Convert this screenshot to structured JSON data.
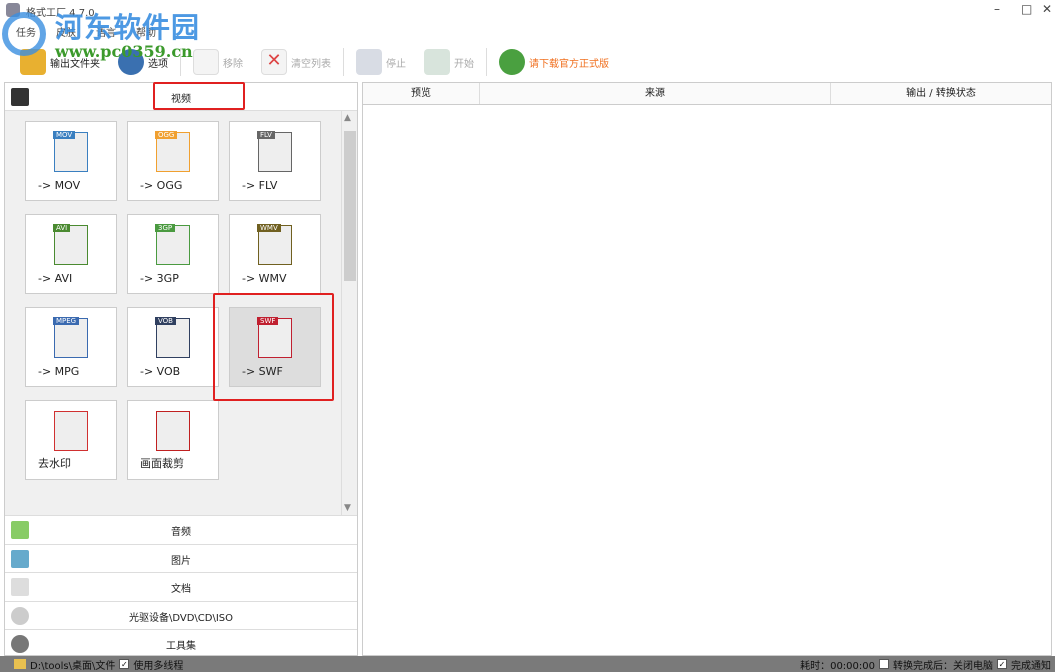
{
  "window": {
    "title": "格式工厂 4.7.0"
  },
  "watermark": {
    "name": "河东软件园",
    "url": "www.pc0359.cn"
  },
  "menu": [
    "任务",
    "皮肤",
    "语言",
    "帮助"
  ],
  "toolbar": [
    {
      "label": "输出文件夹",
      "enabled": true
    },
    {
      "label": "选项",
      "enabled": true
    },
    {
      "label": "移除",
      "enabled": false
    },
    {
      "label": "清空列表",
      "enabled": false
    },
    {
      "label": "停止",
      "enabled": false
    },
    {
      "label": "开始",
      "enabled": false
    },
    {
      "label": "请下载官方正式版",
      "enabled": true,
      "color": "#f07020"
    }
  ],
  "left": {
    "active_category": "视频",
    "tiles": [
      {
        "label": "-> MOV",
        "badge": "MOV",
        "color": "#3a7fc0"
      },
      {
        "label": "-> OGG",
        "badge": "OGG",
        "color": "#f0a030"
      },
      {
        "label": "-> FLV",
        "badge": "FLV",
        "color": "#666"
      },
      {
        "label": "-> AVI",
        "badge": "AVI",
        "color": "#4a8a30"
      },
      {
        "label": "-> 3GP",
        "badge": "3GP",
        "color": "#4a9a40"
      },
      {
        "label": "-> WMV",
        "badge": "WMV",
        "color": "#706020"
      },
      {
        "label": "-> MPG",
        "badge": "MPEG",
        "color": "#3a6ab0"
      },
      {
        "label": "-> VOB",
        "badge": "VOB",
        "color": "#304060"
      },
      {
        "label": "-> SWF",
        "badge": "SWF",
        "color": "#c02030",
        "selected": true
      },
      {
        "label": "去水印",
        "badge": "",
        "color": "#d03030"
      },
      {
        "label": "画面裁剪",
        "badge": "",
        "color": "#c02020"
      }
    ],
    "categories": [
      "音频",
      "图片",
      "文档",
      "光驱设备\\DVD\\CD\\ISO",
      "工具集"
    ]
  },
  "table": {
    "columns": [
      "预览",
      "来源",
      "输出 / 转换状态"
    ]
  },
  "status": {
    "path": "D:\\tools\\桌面\\文件",
    "multithread": "使用多线程",
    "elapsed": "耗时：00:00:00",
    "after_convert": "转换完成后：关闭电脑",
    "notify": "完成通知"
  }
}
